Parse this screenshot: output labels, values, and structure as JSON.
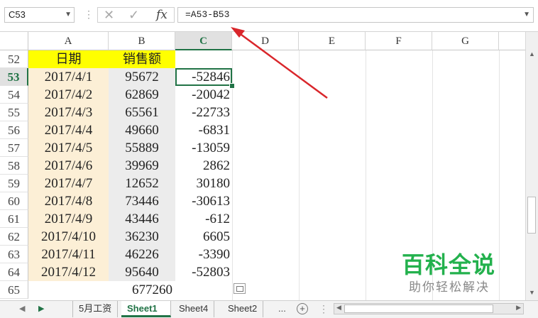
{
  "formula_bar": {
    "name_box": "C53",
    "cancel_icon": "✕",
    "enter_icon": "✓",
    "fx_label": "fx",
    "formula": "=A53-B53"
  },
  "columns": [
    "A",
    "B",
    "C",
    "D",
    "E",
    "F",
    "G"
  ],
  "active_column": "C",
  "header_row": {
    "row": "52",
    "a": "日期",
    "b": "销售额"
  },
  "rows": [
    {
      "row": "53",
      "a": "2017/4/1",
      "b": "95672",
      "c": "-52846"
    },
    {
      "row": "54",
      "a": "2017/4/2",
      "b": "62869",
      "c": "-20042"
    },
    {
      "row": "55",
      "a": "2017/4/3",
      "b": "65561",
      "c": "-22733"
    },
    {
      "row": "56",
      "a": "2017/4/4",
      "b": "49660",
      "c": "-6831"
    },
    {
      "row": "57",
      "a": "2017/4/5",
      "b": "55889",
      "c": "-13059"
    },
    {
      "row": "58",
      "a": "2017/4/6",
      "b": "39969",
      "c": "2862"
    },
    {
      "row": "59",
      "a": "2017/4/7",
      "b": "12652",
      "c": "30180"
    },
    {
      "row": "60",
      "a": "2017/4/8",
      "b": "73446",
      "c": "-30613"
    },
    {
      "row": "61",
      "a": "2017/4/9",
      "b": "43446",
      "c": "-612"
    },
    {
      "row": "62",
      "a": "2017/4/10",
      "b": "36230",
      "c": "6605"
    },
    {
      "row": "63",
      "a": "2017/4/11",
      "b": "46226",
      "c": "-3390"
    },
    {
      "row": "64",
      "a": "2017/4/12",
      "b": "95640",
      "c": "-52803"
    }
  ],
  "total_row": {
    "row": "65",
    "b": "677260"
  },
  "sheet_tabs": [
    "5月工资",
    "Sheet1",
    "Sheet4",
    "Sheet2"
  ],
  "active_sheet": "Sheet1",
  "more_tabs": "...",
  "add_sheet": "+",
  "watermark": {
    "title": "百科全说",
    "subtitle": "助你轻松解决"
  },
  "colors": {
    "accent": "#217346",
    "header_fill": "#ffff00",
    "date_fill": "#fcefd6",
    "sales_fill": "#ececec",
    "arrow": "#d9262b",
    "watermark": "#23b14d"
  }
}
